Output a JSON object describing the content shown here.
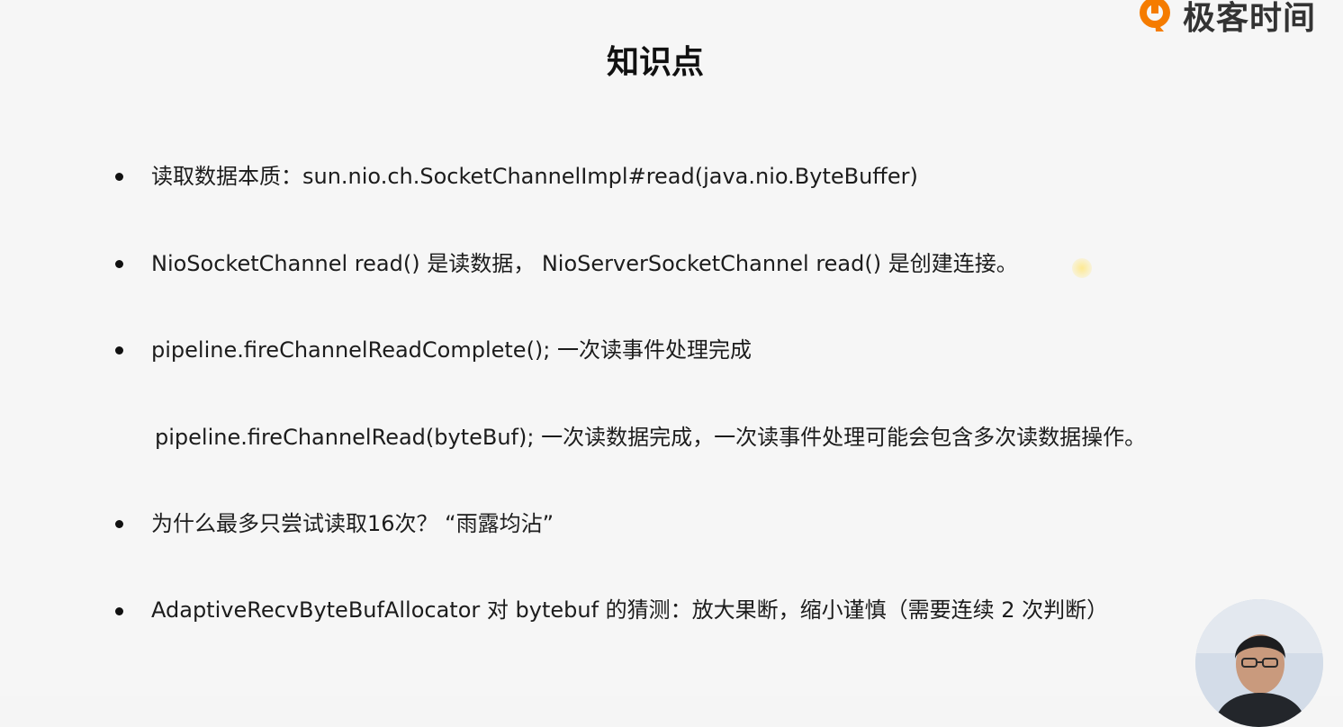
{
  "brand": {
    "name": "极客时间",
    "accent": "#f57c00"
  },
  "title": "知识点",
  "items": [
    {
      "text": "读取数据本质：sun.nio.ch.SocketChannelImpl#read(java.nio.ByteBuffer)"
    },
    {
      "text": "NioSocketChannel read() 是读数据，  NioServerSocketChannel read() 是创建连接。"
    },
    {
      "text": "pipeline.fireChannelReadComplete();  一次读事件处理完成"
    },
    {
      "text": "pipeline.fireChannelRead(byteBuf);  一次读数据完成，一次读事件处理可能会包含多次读数据操作。"
    },
    {
      "text": "为什么最多只尝试读取16次？ “雨露均沾”"
    },
    {
      "text": "AdaptiveRecvByteBufAllocator 对 bytebuf 的猜测：放大果断，缩小谨慎（需要连续 2 次判断）"
    }
  ],
  "icons": {
    "logo": "geektime-logo-icon",
    "cursor": "cursor-highlight-icon",
    "presenter": "presenter-avatar-icon"
  }
}
